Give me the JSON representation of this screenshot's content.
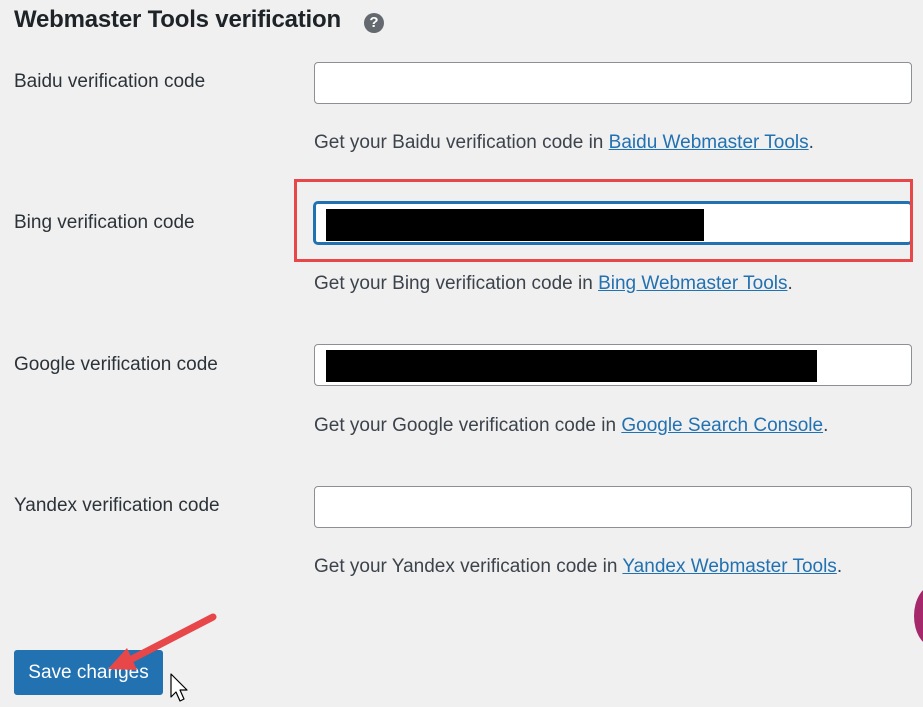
{
  "section": {
    "title": "Webmaster Tools verification",
    "help_icon": "question-circle-icon"
  },
  "fields": [
    {
      "label": "Baidu verification code",
      "value": "",
      "desc_prefix": "Get your Baidu verification code in ",
      "link": "Baidu Webmaster Tools",
      "desc_suffix": "."
    },
    {
      "label": "Bing verification code",
      "value": "",
      "desc_prefix": "Get your Bing verification code in ",
      "link": "Bing Webmaster Tools",
      "desc_suffix": "."
    },
    {
      "label": "Google verification code",
      "value": "",
      "desc_prefix": "Get your Google verification code in ",
      "link": "Google Search Console",
      "desc_suffix": "."
    },
    {
      "label": "Yandex verification code",
      "value": "",
      "desc_prefix": "Get your Yandex verification code in ",
      "link": "Yandex Webmaster Tools",
      "desc_suffix": "."
    }
  ],
  "save_button": {
    "label": "Save changes"
  },
  "colors": {
    "accent": "#2271b1",
    "annotation": "#e8474a",
    "redaction": "#000000"
  }
}
